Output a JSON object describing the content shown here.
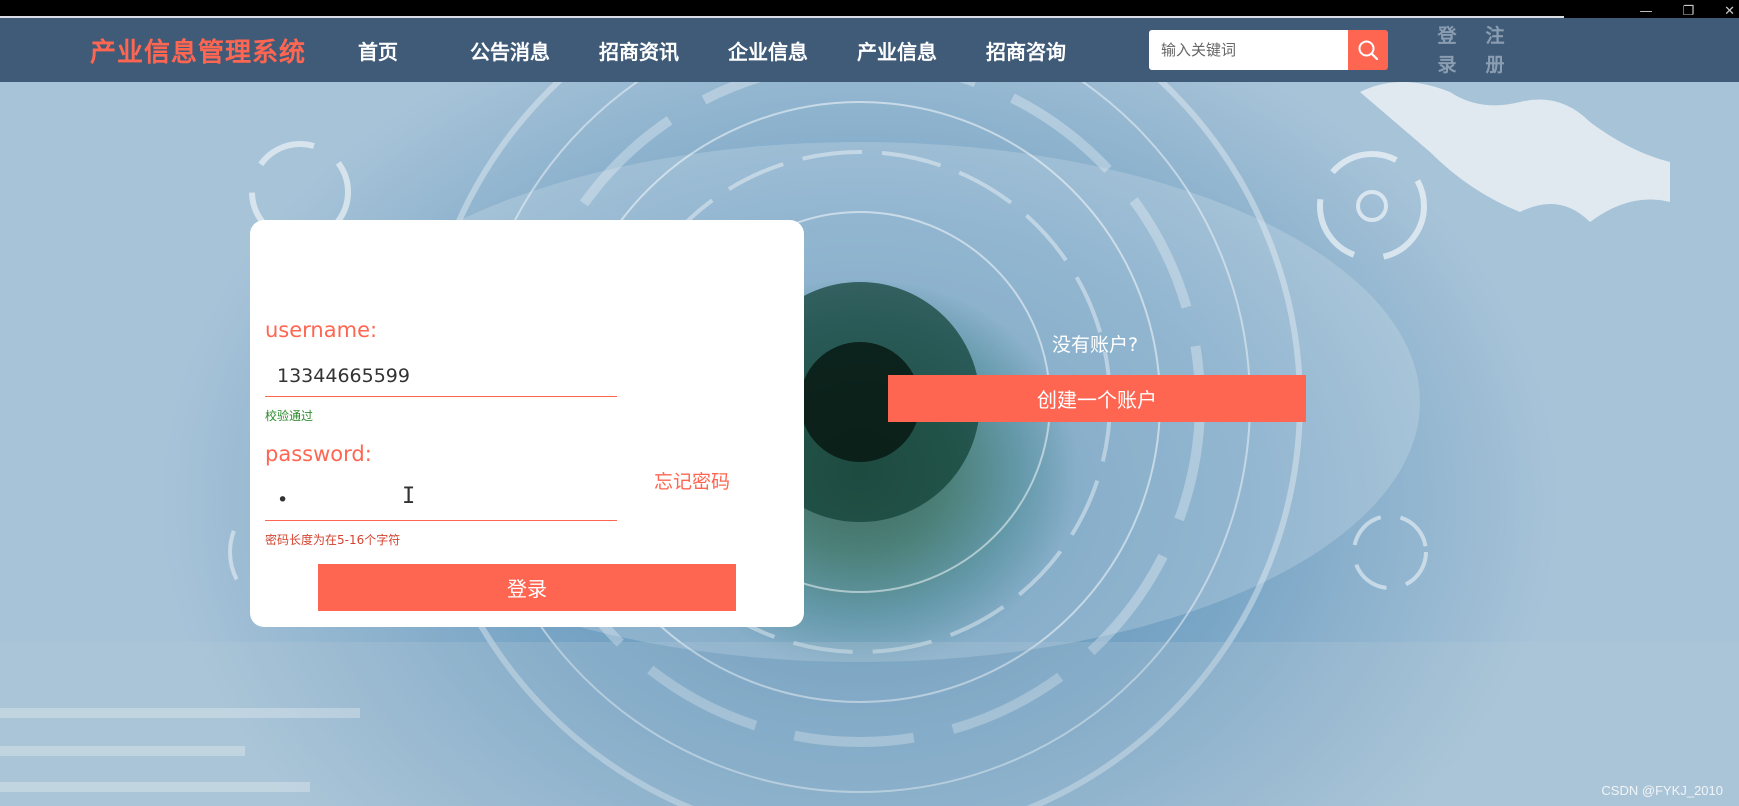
{
  "window": {
    "minimize_glyph": "—",
    "restore_glyph": "❐",
    "close_glyph": "✕"
  },
  "header": {
    "logo": "产业信息管理系统",
    "nav": [
      "首页",
      "公告消息",
      "招商资讯",
      "企业信息",
      "产业信息",
      "招商咨询"
    ],
    "search_placeholder": "输入关键词",
    "search_icon": "search-icon",
    "login_label": "登录",
    "register_label": "注册"
  },
  "login_form": {
    "username_label": "username:",
    "username_value": "13344665599",
    "username_hint": "校验通过",
    "password_label": "password:",
    "password_value": "•",
    "password_hint": "密码长度为在5-16个字符",
    "forgot_label": "忘记密码",
    "submit_label": "登录",
    "text_cursor": "I"
  },
  "register_panel": {
    "prompt": "没有账户?",
    "create_label": "创建一个账户"
  },
  "watermark": "CSDN @FYKJ_2010",
  "colors": {
    "accent": "#ff6652",
    "header_bg": "#3f5b78",
    "success": "#2b8a2b",
    "error": "#d4432f"
  }
}
